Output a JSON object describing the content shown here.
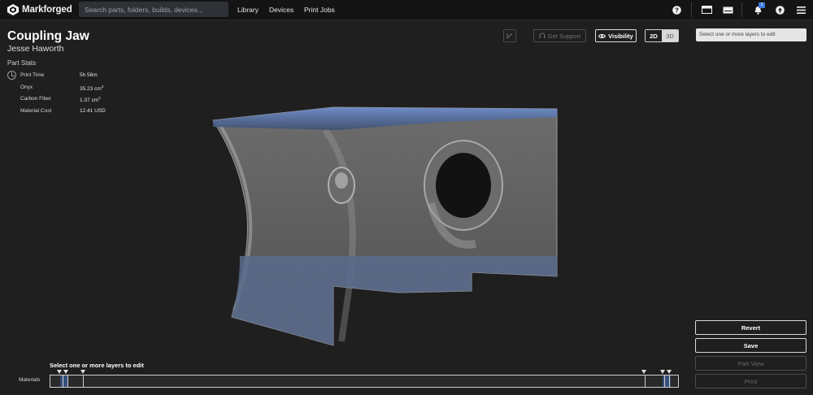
{
  "topbar": {
    "logo_text": "Markforged",
    "search_placeholder": "Search parts, folders, builds, devices...",
    "nav": [
      "Library",
      "Devices",
      "Print Jobs"
    ],
    "notification_count": "2"
  },
  "part": {
    "title": "Coupling Jaw",
    "owner": "Jesse Haworth"
  },
  "stats": {
    "heading": "Part Stats",
    "rows": [
      {
        "label": "Print Time",
        "value": "5h 56m"
      },
      {
        "label": "Onyx",
        "value": "35.23 cm",
        "sup": "3"
      },
      {
        "label": "Carbon Fiber",
        "value": "1.37 cm",
        "sup": "3"
      },
      {
        "label": "Material Cost",
        "value": "12.41 USD"
      }
    ]
  },
  "toolbar": {
    "support_label": "Get Support",
    "visibility_label": "Visibility",
    "view_2d": "2D",
    "view_3d": "3D"
  },
  "right_panel": {
    "layer_placeholder": "Select one or more layers to edit",
    "revert": "Revert",
    "save": "Save",
    "part_view": "Part View",
    "print": "Print"
  },
  "slider": {
    "label": "Select one or more layers to edit",
    "materials_label": "Materials"
  },
  "colors": {
    "background": "#1f1f1f",
    "topbar": "#141414",
    "fiber_blue": "#6f8fd0",
    "onyx_gray": "#8a8a8a"
  }
}
